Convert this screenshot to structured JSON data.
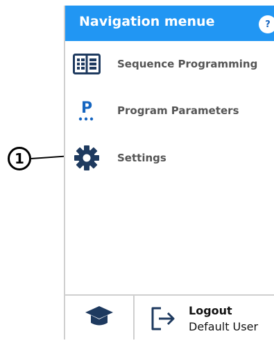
{
  "header": {
    "title": "Navigation menue",
    "help_label": "?"
  },
  "nav": {
    "items": [
      {
        "label": "Sequence Programming",
        "icon": "sequence-list-icon"
      },
      {
        "label": "Program Parameters",
        "icon": "program-parameters-icon"
      },
      {
        "label": "Settings",
        "icon": "gear-icon"
      }
    ]
  },
  "footer": {
    "education_icon": "graduation-cap-icon",
    "logout_icon": "logout-icon",
    "logout_label": "Logout",
    "user_name": "Default User"
  },
  "annotation": {
    "callout_number": "1"
  },
  "colors": {
    "header_bg": "#2196f3",
    "icon_navy": "#1e3a5f",
    "accent_blue": "#1565c0",
    "label_gray": "#555555"
  }
}
